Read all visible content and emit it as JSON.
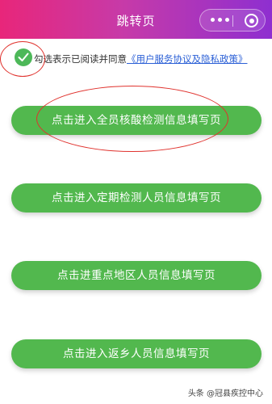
{
  "header": {
    "title": "跳转页",
    "menu_icon": "more-dots-icon",
    "close_icon": "target-icon"
  },
  "agreement": {
    "text": "勾选表示已阅读并同意",
    "link": "《用户服务协议及隐私政策》",
    "checked": true
  },
  "buttons": [
    {
      "label": "点击进入全员核酸检测信息填写页"
    },
    {
      "label": "点击进入定期检测人员信息填写页"
    },
    {
      "label": "点击进重点地区人员信息填写页"
    },
    {
      "label": "点击进入返乡人员信息填写页"
    }
  ],
  "watermark": "头条 @冠县疾控中心",
  "colors": {
    "nav_gradient_start": "#e8267a",
    "nav_gradient_end": "#8e2fd0",
    "button_green": "#52b84e",
    "check_green": "#4db859",
    "link_blue": "#2a5fd6",
    "annotation_red": "#e0322d"
  }
}
